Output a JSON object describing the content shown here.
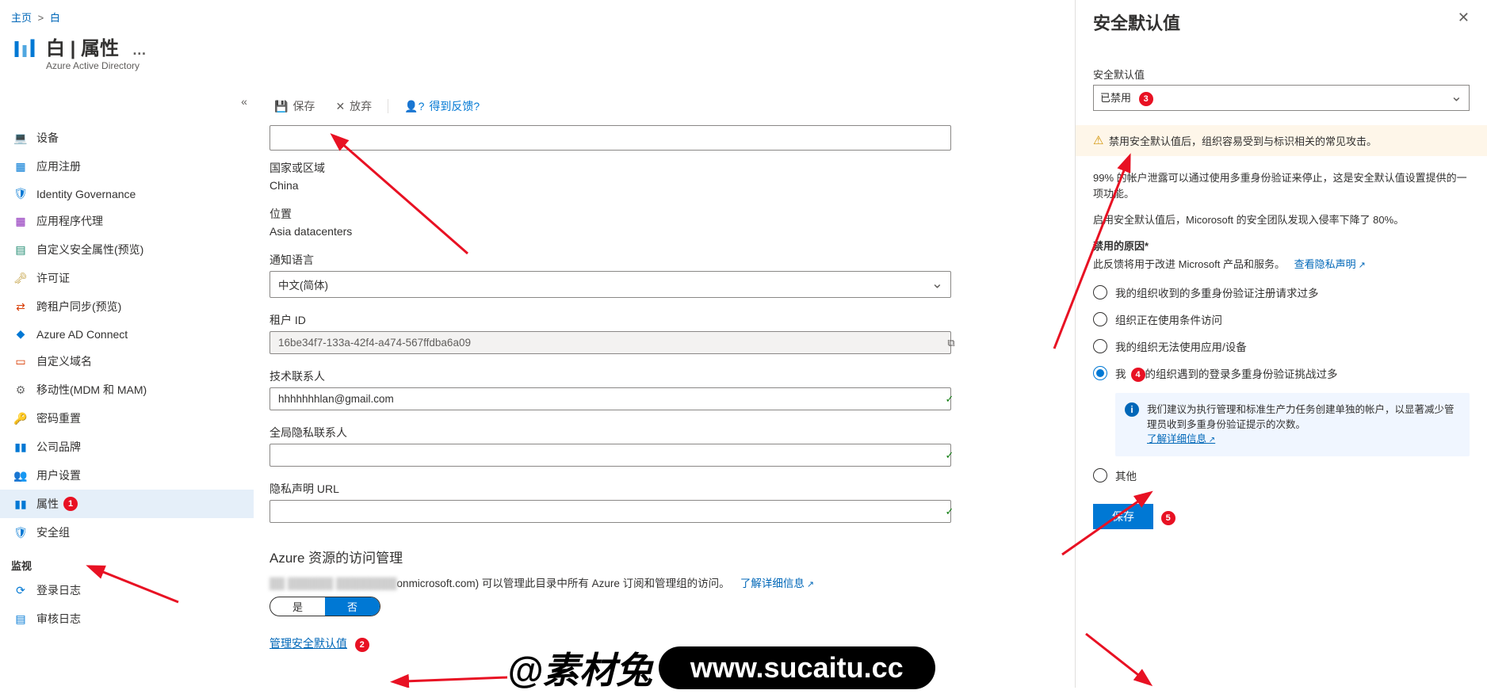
{
  "breadcrumb": {
    "home": "主页",
    "sep": ">",
    "tenant": "白"
  },
  "header": {
    "title": "白 | 属性",
    "subtitle": "Azure Active Directory",
    "more": "…"
  },
  "nav_collapse": "«",
  "sidebar": {
    "items": [
      {
        "icon": "💻",
        "label": "设备",
        "iconColor": "#8b6b3e"
      },
      {
        "icon": "▦",
        "label": "应用注册",
        "iconColor": "#0078d4"
      },
      {
        "icon": "🛡",
        "label": "Identity Governance",
        "iconColor": "#0078d4"
      },
      {
        "icon": "▦",
        "label": "应用程序代理",
        "iconColor": "#8b2ab8"
      },
      {
        "icon": "▤",
        "label": "自定义安全属性(预览)",
        "iconColor": "#1f8a70"
      },
      {
        "icon": "🗝",
        "label": "许可证",
        "iconColor": "#c29e3d"
      },
      {
        "icon": "⇄",
        "label": "跨租户同步(预览)",
        "iconColor": "#d83b01"
      },
      {
        "icon": "◆",
        "label": "Azure AD Connect",
        "iconColor": "#0078d4"
      },
      {
        "icon": "▭",
        "label": "自定义域名",
        "iconColor": "#d83b01"
      },
      {
        "icon": "⚙",
        "label": "移动性(MDM 和 MAM)",
        "iconColor": "#6b6b6b"
      },
      {
        "icon": "🔑",
        "label": "密码重置",
        "iconColor": "#c29e3d"
      },
      {
        "icon": "▮▮",
        "label": "公司品牌",
        "iconColor": "#0078d4"
      },
      {
        "icon": "👥",
        "label": "用户设置",
        "iconColor": "#0078d4"
      },
      {
        "icon": "▮▮",
        "label": "属性",
        "badge": "1",
        "selected": true,
        "iconColor": "#0078d4"
      },
      {
        "icon": "🛡",
        "label": "安全组",
        "iconColor": "#0078d4"
      }
    ],
    "section_monitoring": "监视",
    "monitoring": [
      {
        "icon": "⟳",
        "label": "登录日志",
        "iconColor": "#0078d4"
      },
      {
        "icon": "▤",
        "label": "审核日志",
        "iconColor": "#0078d4"
      }
    ]
  },
  "toolbar": {
    "save": "保存",
    "discard": "放弃",
    "feedback": "得到反馈?"
  },
  "form": {
    "name_input": "",
    "country_label": "国家或区域",
    "country_value": "China",
    "location_label": "位置",
    "location_value": "Asia datacenters",
    "notif_lang_label": "通知语言",
    "notif_lang_value": "中文(简体)",
    "tenant_id_label": "租户 ID",
    "tenant_id_value": "16be34f7-133a-42f4-a474-567ffdba6a09",
    "tech_contact_label": "技术联系人",
    "tech_contact_value": "hhhhhhhlan@gmail.com",
    "global_privacy_label": "全局隐私联系人",
    "privacy_url_label": "隐私声明 URL",
    "access_heading": "Azure 资源的访问管理",
    "access_text_tail": "onmicrosoft.com) 可以管理此目录中所有 Azure 订阅和管理组的访问。",
    "learn_more": "了解详细信息",
    "toggle_yes": "是",
    "toggle_no": "否",
    "manage_defaults": "管理安全默认值",
    "manage_badge": "2"
  },
  "flyout": {
    "title": "安全默认值",
    "dropdown_label": "安全默认值",
    "dropdown_value": "已禁用",
    "dropdown_badge": "3",
    "warning": "禁用安全默认值后，组织容易受到与标识相关的常见攻击。",
    "p1": "99% 的帐户泄露可以通过使用多重身份验证来停止，这是安全默认值设置提供的一项功能。",
    "p2": "启用安全默认值后，Micorosoft 的安全团队发现入侵率下降了 80%。",
    "reason_title": "禁用的原因*",
    "reason_subtitle": "此反馈将用于改进 Microsoft 产品和服务。",
    "privacy_link": "查看隐私声明",
    "radios": [
      {
        "label": "我的组织收到的多重身份验证注册请求过多",
        "checked": false
      },
      {
        "label": "组织正在使用条件访问",
        "checked": false
      },
      {
        "label": "我的组织无法使用应用/设备",
        "checked": false
      },
      {
        "label": "我的组织遇到的登录多重身份验证挑战过多",
        "checked": true,
        "badge": "4"
      },
      {
        "label": "其他",
        "checked": false
      }
    ],
    "radio_selected_prefix": "我",
    "info_text": "我们建议为执行管理和标准生产力任务创建单独的帐户，以显著减少管理员收到多重身份验证提示的次数。",
    "info_link": "了解详细信息",
    "save_btn": "保存",
    "save_badge": "5"
  },
  "watermark": {
    "left": "@素材兔",
    "right": "www.sucaitu.cc"
  }
}
